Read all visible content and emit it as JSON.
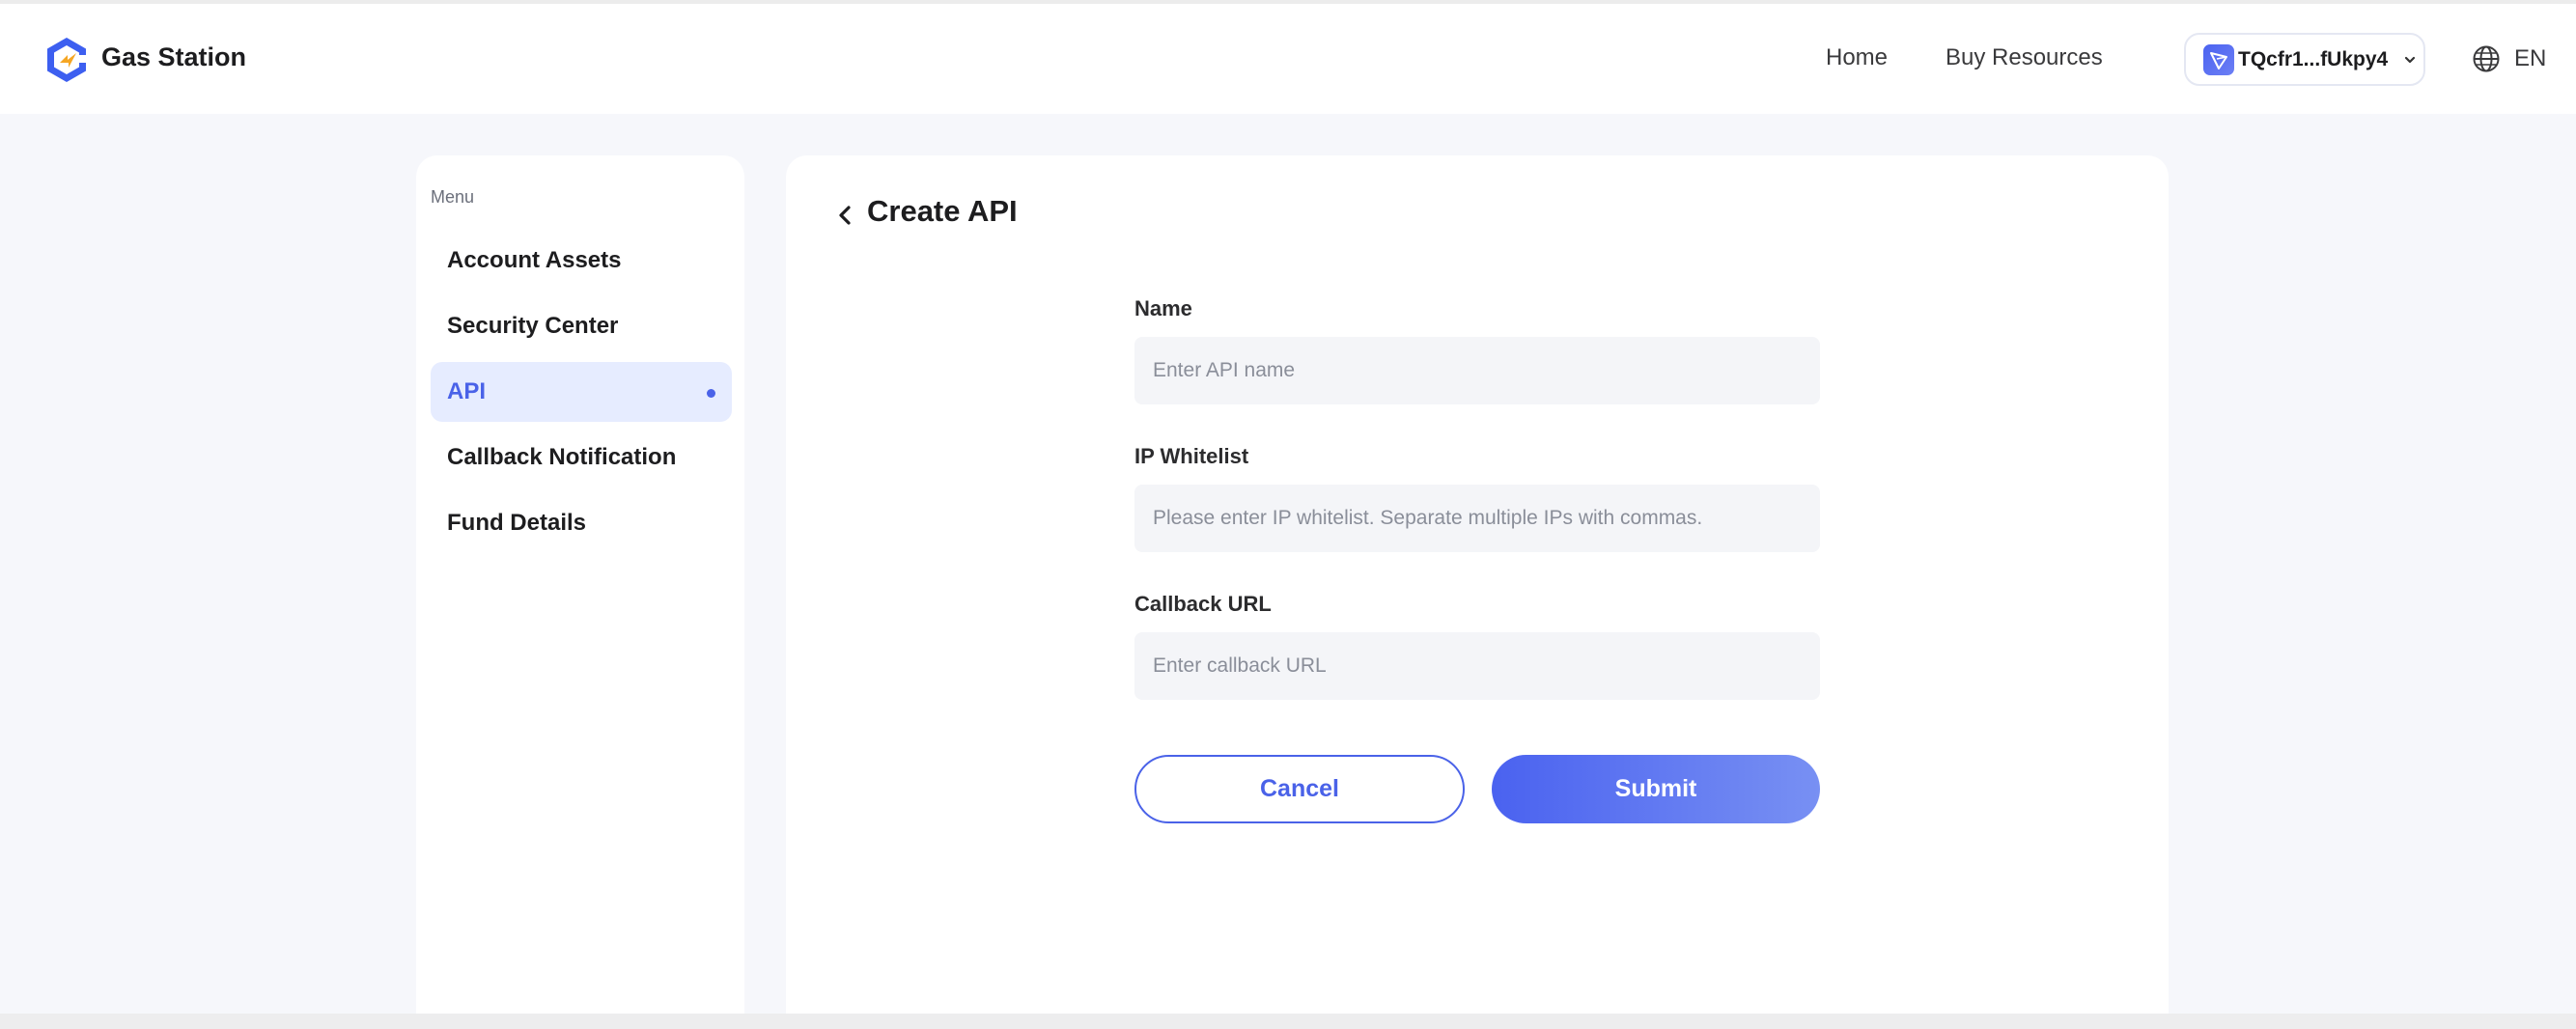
{
  "header": {
    "brand": "Gas Station",
    "nav": {
      "home": "Home",
      "buy_resources": "Buy Resources"
    },
    "wallet": {
      "address": "TQcfr1...fUkpy4"
    },
    "language": "EN"
  },
  "sidebar": {
    "title": "Menu",
    "items": [
      {
        "label": "Account Assets"
      },
      {
        "label": "Security Center"
      },
      {
        "label": "API",
        "active": true
      },
      {
        "label": "Callback Notification"
      },
      {
        "label": "Fund Details"
      }
    ]
  },
  "form": {
    "title": "Create API",
    "name_label": "Name",
    "name_placeholder": "Enter API name",
    "name_value": "",
    "ip_label": "IP Whitelist",
    "ip_placeholder": "Please enter IP whitelist. Separate multiple IPs with commas.",
    "ip_value": "",
    "callback_label": "Callback URL",
    "callback_placeholder": "Enter callback URL",
    "callback_value": "",
    "cancel": "Cancel",
    "submit": "Submit"
  },
  "colors": {
    "accent": "#4a62e8",
    "active_bg": "#e6ecff",
    "page_bg": "#f6f7fb",
    "logo_blue": "#3d5ff0",
    "logo_orange": "#f5a623"
  },
  "icons": {
    "logo": "gas-station-logo",
    "wallet": "tron-wallet-icon",
    "wallet_chevron": "chevron-down-icon",
    "language": "globe-icon",
    "back": "chevron-left-icon"
  }
}
